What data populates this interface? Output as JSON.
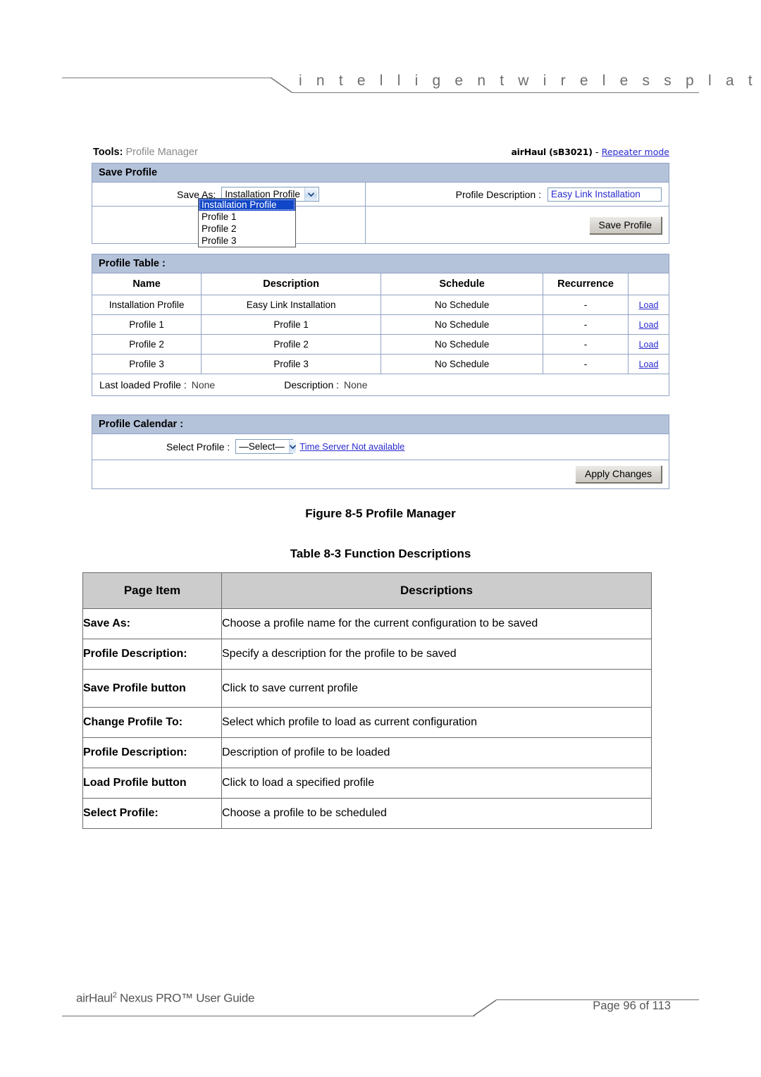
{
  "header": {
    "tagline": "i n t e l l i g e n t     w i r e l e s s     p l a t f o r m"
  },
  "screenshot": {
    "breadcrumb": {
      "section": "Tools",
      "separator": ":",
      "page": "Profile Manager"
    },
    "device_info": {
      "device": "airHaul (sB3021)",
      "dash": "-",
      "mode_link": "Repeater mode"
    },
    "save_profile_panel": {
      "title": "Save Profile",
      "save_as_label": "Save As:",
      "save_as_value": "Installation Profile",
      "save_as_options": [
        "Installation Profile",
        "Profile 1",
        "Profile 2",
        "Profile 3"
      ],
      "profile_description_label": "Profile Description :",
      "profile_description_value": "Easy Link Installation",
      "save_button": "Save Profile"
    },
    "profile_table_panel": {
      "title": "Profile Table :",
      "columns": [
        "Name",
        "Description",
        "Schedule",
        "Recurrence",
        ""
      ],
      "rows": [
        {
          "name": "Installation Profile",
          "description": "Easy Link Installation",
          "schedule": "No Schedule",
          "recurrence": "-",
          "action": "Load"
        },
        {
          "name": "Profile 1",
          "description": "Profile 1",
          "schedule": "No Schedule",
          "recurrence": "-",
          "action": "Load"
        },
        {
          "name": "Profile 2",
          "description": "Profile 2",
          "schedule": "No Schedule",
          "recurrence": "-",
          "action": "Load"
        },
        {
          "name": "Profile 3",
          "description": "Profile 3",
          "schedule": "No Schedule",
          "recurrence": "-",
          "action": "Load"
        }
      ],
      "last_loaded_label": "Last loaded Profile :",
      "last_loaded_value": "None",
      "last_desc_label": "Description :",
      "last_desc_value": "None"
    },
    "profile_calendar_panel": {
      "title": "Profile Calendar :",
      "select_profile_label": "Select Profile :",
      "select_profile_value": "—Select—",
      "select_profile_options": [
        "—Select—"
      ],
      "time_server_link": "Time Server Not available",
      "apply_button": "Apply Changes"
    }
  },
  "figure_caption": "Figure 8-5 Profile Manager",
  "table_caption": "Table 8-3 Function Descriptions",
  "function_table": {
    "columns": [
      "Page Item",
      "Descriptions"
    ],
    "rows": [
      {
        "item": "Save As:",
        "desc": "Choose a profile name for the current configuration to be saved",
        "tall": false
      },
      {
        "item": "Profile Description:",
        "desc": "Specify a description for the profile to be saved",
        "tall": false
      },
      {
        "item": "Save Profile button",
        "desc": "Click to save current profile",
        "tall": true
      },
      {
        "item": "Change Profile To:",
        "desc": "Select which profile to load as current configuration",
        "tall": false
      },
      {
        "item": "Profile Description:",
        "desc": "Description of profile to be loaded",
        "tall": false
      },
      {
        "item": "Load Profile button",
        "desc": "Click to load a specified profile",
        "tall": false
      },
      {
        "item": "Select Profile:",
        "desc": "Choose a profile to be scheduled",
        "tall": false
      }
    ]
  },
  "footer": {
    "guide_prefix": "airHaul",
    "guide_sup": "2",
    "guide_suffix": " Nexus PRO™ User Guide",
    "page_label": "Page 96 of 113"
  },
  "colors": {
    "panel_header": "#b4c2da",
    "panel_border": "#8fa3c4",
    "link": "#2a2ad0",
    "table_header_gray": "#cccccc",
    "dropdown_highlight": "#1146c8"
  }
}
